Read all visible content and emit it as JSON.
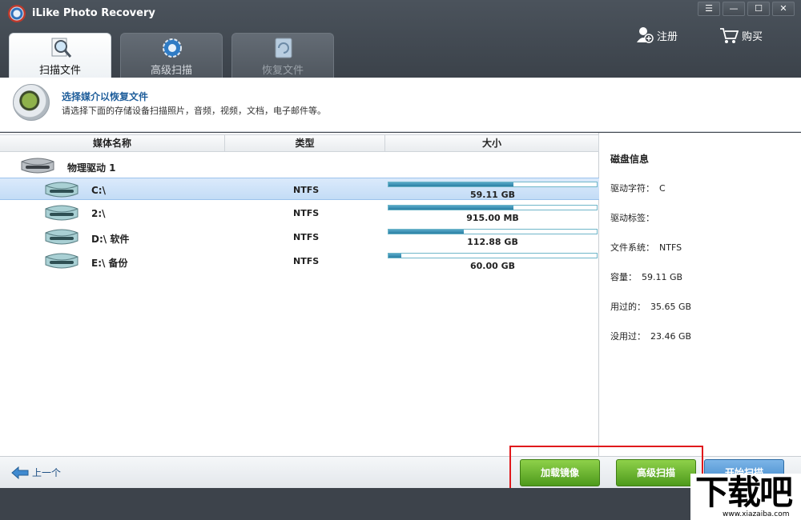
{
  "window": {
    "title": "iLike Photo Recovery",
    "controls": [
      "☰",
      "—",
      "☐",
      "✕"
    ]
  },
  "tabs": [
    {
      "label": "扫描文件",
      "icon": "magnifier-icon",
      "active": true
    },
    {
      "label": "高级扫描",
      "icon": "gear-icon",
      "active": false
    },
    {
      "label": "恢复文件",
      "icon": "recover-icon",
      "active": false,
      "disabled": true
    }
  ],
  "top_actions": {
    "register": "注册",
    "buy": "购买"
  },
  "header": {
    "title": "选择媒介以恢复文件",
    "subtitle": "请选择下面的存储设备扫描照片，音频，视频，文档，电子邮件等。"
  },
  "columns": {
    "name": "媒体名称",
    "type": "类型",
    "size": "大小"
  },
  "group_label": "物理驱动 1",
  "drives": [
    {
      "name": "C:\\",
      "type": "NTFS",
      "size": "59.11 GB",
      "used_fraction": 0.6,
      "selected": true
    },
    {
      "name": "2:\\",
      "type": "NTFS",
      "size": "915.00 MB",
      "used_fraction": 0.6,
      "selected": false
    },
    {
      "name": "D:\\ 软件",
      "type": "NTFS",
      "size": "112.88 GB",
      "used_fraction": 0.36,
      "selected": false
    },
    {
      "name": "E:\\ 备份",
      "type": "NTFS",
      "size": "60.00 GB",
      "used_fraction": 0.06,
      "selected": false
    }
  ],
  "disk_info": {
    "title": "磁盘信息",
    "rows": [
      {
        "key": "驱动字符：",
        "value": "C"
      },
      {
        "key": "驱动标签：",
        "value": ""
      },
      {
        "key": "文件系统：",
        "value": "NTFS"
      },
      {
        "key": "容量：",
        "value": "59.11 GB"
      },
      {
        "key": "用过的：",
        "value": "35.65 GB"
      },
      {
        "key": "没用过：",
        "value": "23.46 GB"
      }
    ]
  },
  "footer": {
    "back": "上一个",
    "load_image": "加载镜像",
    "advanced_scan": "高级扫描",
    "start_scan": "开始扫描"
  },
  "watermark": {
    "main": "下载吧",
    "url": "www.xiazaiba.com"
  },
  "colors": {
    "accent": "#1f5e9b",
    "green_button": "#5aa823",
    "blue_button": "#3c84c7",
    "highlight": "#e0191c"
  }
}
